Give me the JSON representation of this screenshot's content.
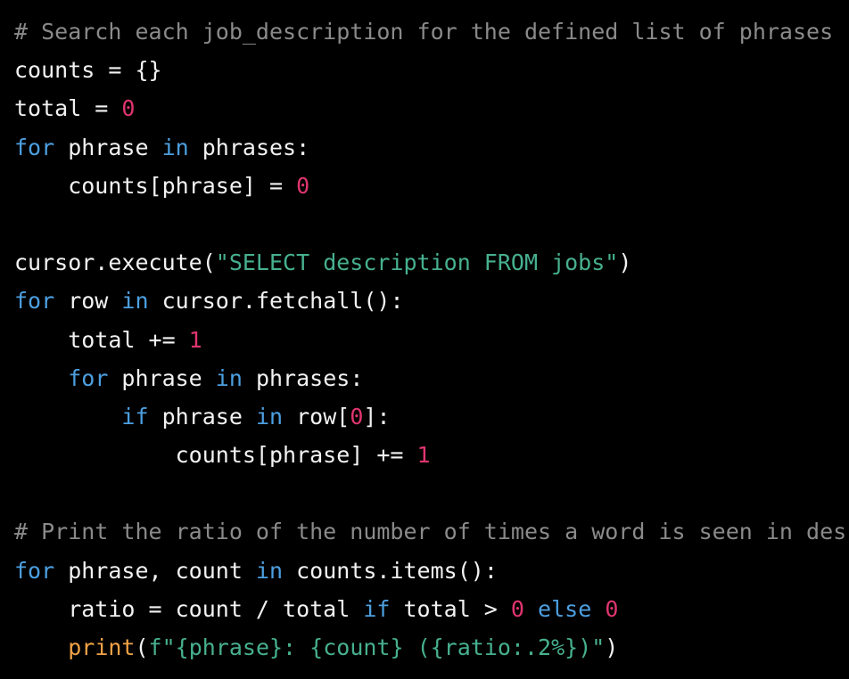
{
  "editor": {
    "language": "python",
    "theme": {
      "background": "#000000",
      "text": "#f2f2f2",
      "comment": "#8a8a8a",
      "keyword": "#4d9fe0",
      "number": "#e0356f",
      "string": "#47b08f",
      "builtin": "#f0a247"
    },
    "lines": [
      [
        {
          "t": "comment",
          "v": "# Search each job_description for the defined list of phrases"
        }
      ],
      [
        {
          "t": "plain",
          "v": "counts = {}"
        }
      ],
      [
        {
          "t": "plain",
          "v": "total = "
        },
        {
          "t": "number",
          "v": "0"
        }
      ],
      [
        {
          "t": "keyword",
          "v": "for"
        },
        {
          "t": "plain",
          "v": " phrase "
        },
        {
          "t": "keyword",
          "v": "in"
        },
        {
          "t": "plain",
          "v": " phrases:"
        }
      ],
      [
        {
          "t": "plain",
          "v": "    counts[phrase] = "
        },
        {
          "t": "number",
          "v": "0"
        }
      ],
      [],
      [
        {
          "t": "plain",
          "v": "cursor.execute("
        },
        {
          "t": "string",
          "v": "\"SELECT description FROM jobs\""
        },
        {
          "t": "plain",
          "v": ")"
        }
      ],
      [
        {
          "t": "keyword",
          "v": "for"
        },
        {
          "t": "plain",
          "v": " row "
        },
        {
          "t": "keyword",
          "v": "in"
        },
        {
          "t": "plain",
          "v": " cursor.fetchall():"
        }
      ],
      [
        {
          "t": "plain",
          "v": "    total += "
        },
        {
          "t": "number",
          "v": "1"
        }
      ],
      [
        {
          "t": "plain",
          "v": "    "
        },
        {
          "t": "keyword",
          "v": "for"
        },
        {
          "t": "plain",
          "v": " phrase "
        },
        {
          "t": "keyword",
          "v": "in"
        },
        {
          "t": "plain",
          "v": " phrases:"
        }
      ],
      [
        {
          "t": "plain",
          "v": "        "
        },
        {
          "t": "keyword",
          "v": "if"
        },
        {
          "t": "plain",
          "v": " phrase "
        },
        {
          "t": "keyword",
          "v": "in"
        },
        {
          "t": "plain",
          "v": " row["
        },
        {
          "t": "number",
          "v": "0"
        },
        {
          "t": "plain",
          "v": "]:"
        }
      ],
      [
        {
          "t": "plain",
          "v": "            counts[phrase] += "
        },
        {
          "t": "number",
          "v": "1"
        }
      ],
      [],
      [
        {
          "t": "comment",
          "v": "# Print the ratio of the number of times a word is seen in des"
        }
      ],
      [
        {
          "t": "keyword",
          "v": "for"
        },
        {
          "t": "plain",
          "v": " phrase, count "
        },
        {
          "t": "keyword",
          "v": "in"
        },
        {
          "t": "plain",
          "v": " counts.items():"
        }
      ],
      [
        {
          "t": "plain",
          "v": "    ratio = count / total "
        },
        {
          "t": "keyword",
          "v": "if"
        },
        {
          "t": "plain",
          "v": " total > "
        },
        {
          "t": "number",
          "v": "0"
        },
        {
          "t": "plain",
          "v": " "
        },
        {
          "t": "keyword",
          "v": "else"
        },
        {
          "t": "plain",
          "v": " "
        },
        {
          "t": "number",
          "v": "0"
        }
      ],
      [
        {
          "t": "plain",
          "v": "    "
        },
        {
          "t": "builtin",
          "v": "print"
        },
        {
          "t": "plain",
          "v": "("
        },
        {
          "t": "string",
          "v": "f\"{phrase}: {count} ({ratio:.2%})\""
        },
        {
          "t": "plain",
          "v": ")"
        }
      ]
    ]
  }
}
